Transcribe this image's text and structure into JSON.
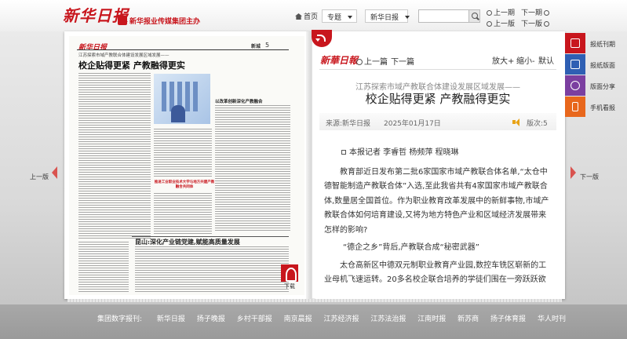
{
  "header": {
    "logo_text": "新华日报",
    "slogan": "新华报业传媒集团主办",
    "home_label": "首页",
    "topic_select": "专题",
    "paper_select": "新华日报",
    "search_placeholder": "",
    "prev_issue": "上一期",
    "next_issue": "下一期",
    "prev_page": "上一版",
    "next_page": "下一版"
  },
  "newspaper_page": {
    "logo": "新华日报",
    "section": "新城",
    "page_number": "5",
    "kicker": "江苏探索市域产教联合体建设发展区域发展——",
    "headline": "校企贴得更紧 产教融得更实",
    "side_headline": "以改革创新深化产教融合",
    "mid_caption": "推进工业职业技术大学与地方共建产教融合共同体",
    "sub_headline": "昆山:深化产业链党建,赋能高质量发展"
  },
  "download_label": "下载",
  "article": {
    "logo": "新華日報",
    "prev_article": "上一篇",
    "next_article": "下一篇",
    "zoom_in": "放大+",
    "zoom_out": "缩小-",
    "default": "默认",
    "kicker": "江苏探索市域产教联合体建设发展区域发展——",
    "title": "校企贴得更紧 产教融得更实",
    "source": "来源:新华日报",
    "date": "2025年01月17日",
    "edition": "版次:5",
    "byline": "本报记者 李睿哲 杨频萍 程晓琳",
    "paragraphs": [
      "教育部近日发布第二批6家国家市域产教联合体名单,“太仓中德智能制造产教联合体”入选,至此我省共有4家国家市域产教联合体,数量居全国首位。作为职业教育改革发展中的新鲜事物,市域产教联合体如何培育建设,又将为地方特色产业和区域经济发展带来怎样的影响?",
      "“德企之乡”背后,产教联合成“秘密武器”",
      "太仓高新区中德双元制职业教育产业园,数控车铣区崭新的工业母机飞速运转。20多名校企联合培养的学徒们围在一旁跃跃欲试。"
    ]
  },
  "side_nav": {
    "prev": "上一版",
    "next": "下一版"
  },
  "tools": [
    {
      "label": "报纸刊期",
      "icon": "calendar-icon",
      "color": "#c8161d"
    },
    {
      "label": "报纸版面",
      "icon": "list-icon",
      "color": "#2f5fb3"
    },
    {
      "label": "版面分享",
      "icon": "share-icon",
      "color": "#7b3fa0"
    },
    {
      "label": "手机看报",
      "icon": "phone-icon",
      "color": "#e8671c"
    }
  ],
  "footer": {
    "lead": "集团数字报刊:",
    "links": [
      "新华日报",
      "扬子晚报",
      "乡村干部报",
      "南京晨报",
      "江苏经济报",
      "江苏法治报",
      "江南时报",
      "新苏商",
      "扬子体育报",
      "华人时刊"
    ]
  }
}
